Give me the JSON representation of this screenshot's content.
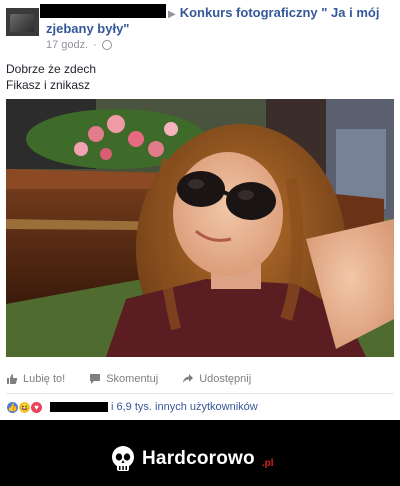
{
  "post": {
    "group_name": "Konkurs fotograficzny \" Ja i mój",
    "group_name_cont": "zjebany były\"",
    "time": "17 godz.",
    "caption_lines": [
      "Dobrze że zdech",
      "Fikasz i znikasz"
    ]
  },
  "actions": {
    "like": "Lubię to!",
    "comment": "Skomentuj",
    "share": "Udostępnij"
  },
  "reactions": {
    "summary": "i 6,9 tys. innych użytkowników"
  },
  "footer": {
    "brand": "Hardcorowo",
    "brand_suffix": ".pl"
  },
  "colors": {
    "link": "#365899",
    "muted": "#90949c",
    "footer_bg": "#000000",
    "brand_accent": "#d32222"
  }
}
